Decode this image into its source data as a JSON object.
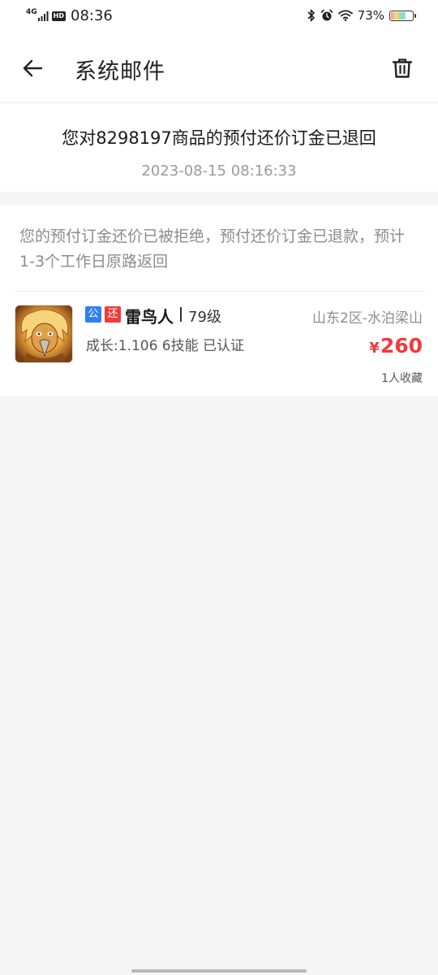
{
  "status_bar": {
    "network": "4G",
    "hd_badge": "HD",
    "time": "08:36",
    "battery_percent": "73%",
    "battery_level": 0.73,
    "icons": [
      "signal-icon",
      "bluetooth-icon",
      "alarm-icon",
      "wifi-icon",
      "battery-icon"
    ]
  },
  "appbar": {
    "title": "系统邮件",
    "back_icon": "back-arrow-icon",
    "delete_icon": "trash-icon"
  },
  "mail": {
    "title": "您对8298197商品的预付还价订金已退回",
    "timestamp": "2023-08-15 08:16:33",
    "body": "您的预付订金还价已被拒绝，预付还价订金已退款，预计1-3个工作日原路返回"
  },
  "item": {
    "tags": [
      "公",
      "还"
    ],
    "name": "雷鸟人",
    "level": "79级",
    "server": "山东2区-水泊梁山",
    "meta": "成长:1.106 6技能 已认证",
    "price_symbol": "¥",
    "price": "260",
    "favorites": "1人收藏"
  },
  "colors": {
    "accent_red": "#ef3b3b",
    "accent_blue": "#2f7ff5",
    "background": "#f5f5f5"
  }
}
